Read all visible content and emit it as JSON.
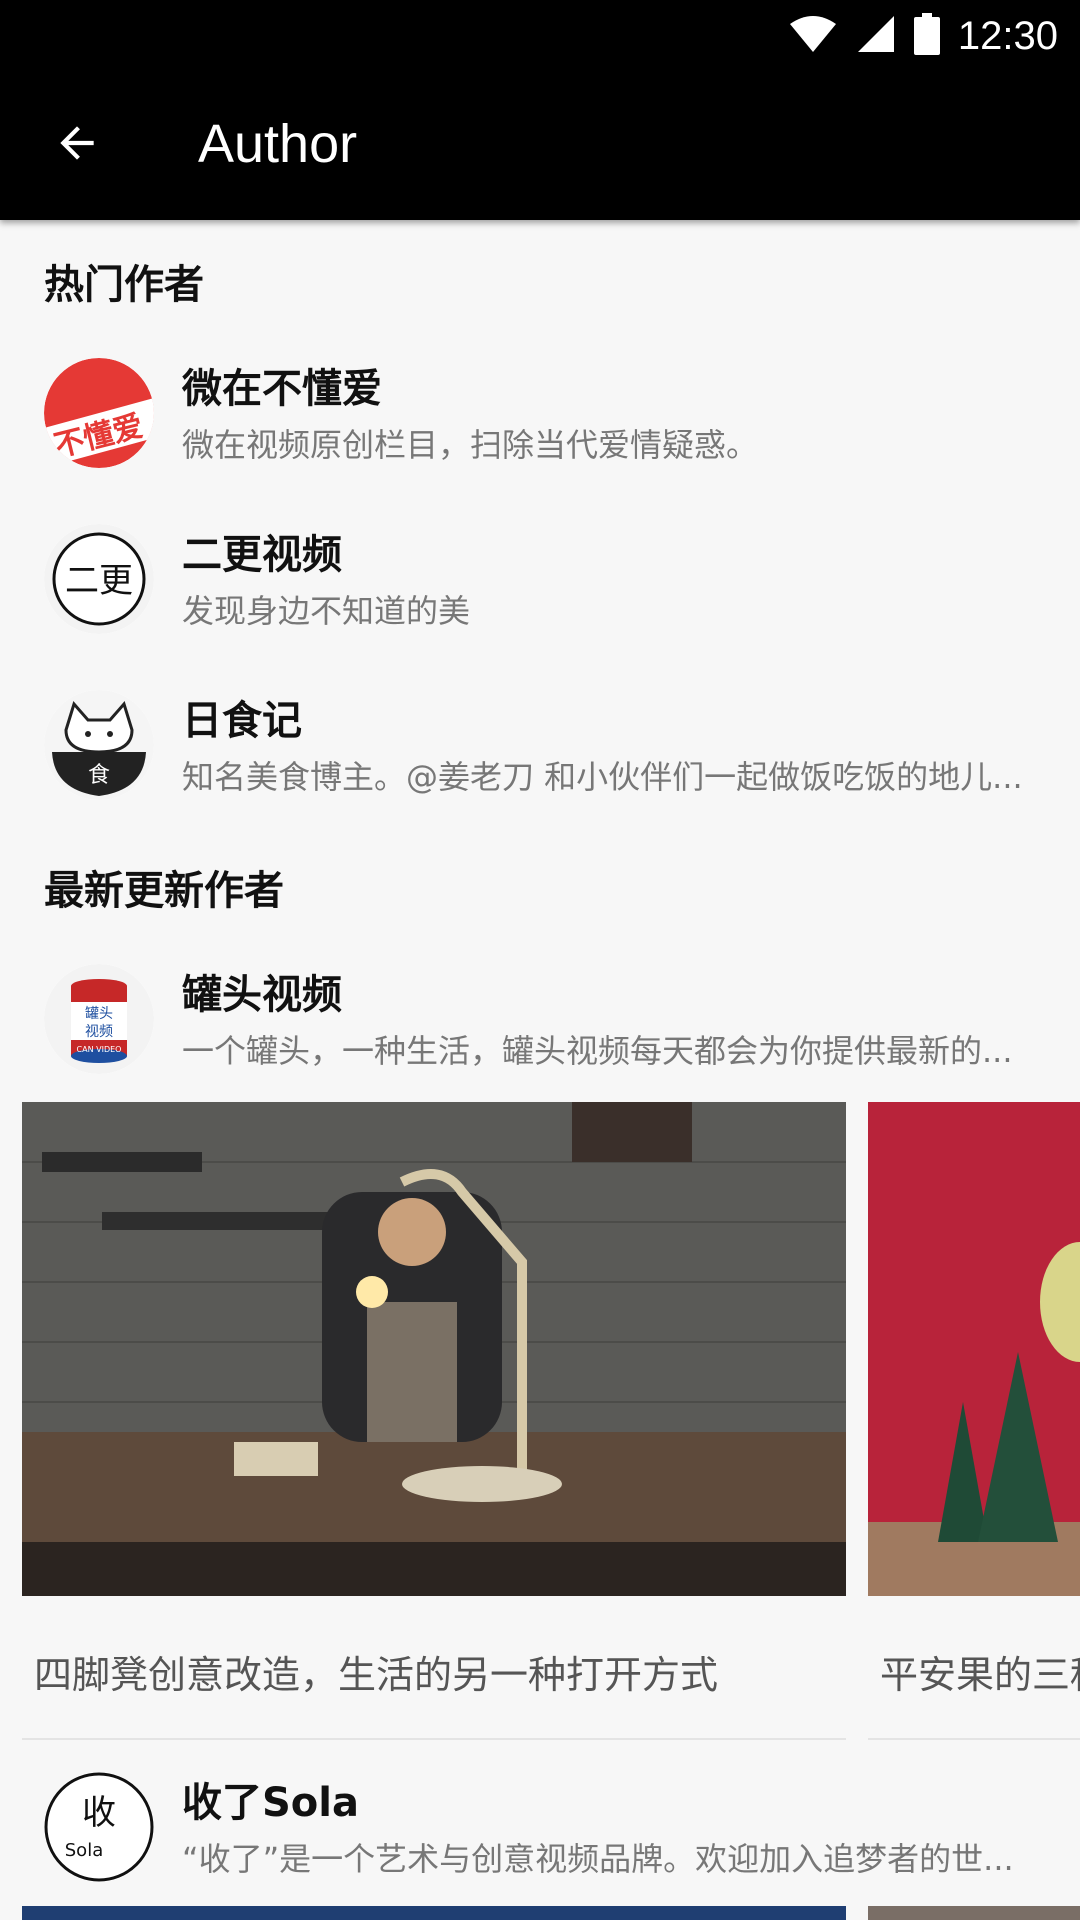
{
  "status_bar": {
    "time": "12:30"
  },
  "app_bar": {
    "title": "Author"
  },
  "sections": {
    "hot": "热门作者",
    "latest": "最新更新作者"
  },
  "hot_authors": [
    {
      "name": "微在不懂爱",
      "desc": "微在视频原创栏目，扫除当代爱情疑惑。",
      "avatar_text": "不懂爱"
    },
    {
      "name": "二更视频",
      "desc": "发现身边不知道的美",
      "avatar_text": "二更"
    },
    {
      "name": "日食记",
      "desc": "知名美食博主。@姜老刀 和小伙伴们一起做饭吃饭的地儿..."
    }
  ],
  "latest_authors": [
    {
      "name": "罐头视频",
      "desc": "一个罐头，一种生活，罐头视频每天都会为你提供最新的...",
      "avatar_text_top": "罐头",
      "avatar_text_mid": "视频",
      "avatar_text_bottom": "CAN VIDEO",
      "videos": [
        {
          "title": "四脚凳创意改造，生活的另一种打开方式"
        },
        {
          "title": "平安果的三种"
        }
      ]
    },
    {
      "name": "收了Sola",
      "desc": "“收了”是一个艺术与创意视频品牌。欢迎加入追梦者的世...",
      "avatar_text": "Sola"
    }
  ]
}
